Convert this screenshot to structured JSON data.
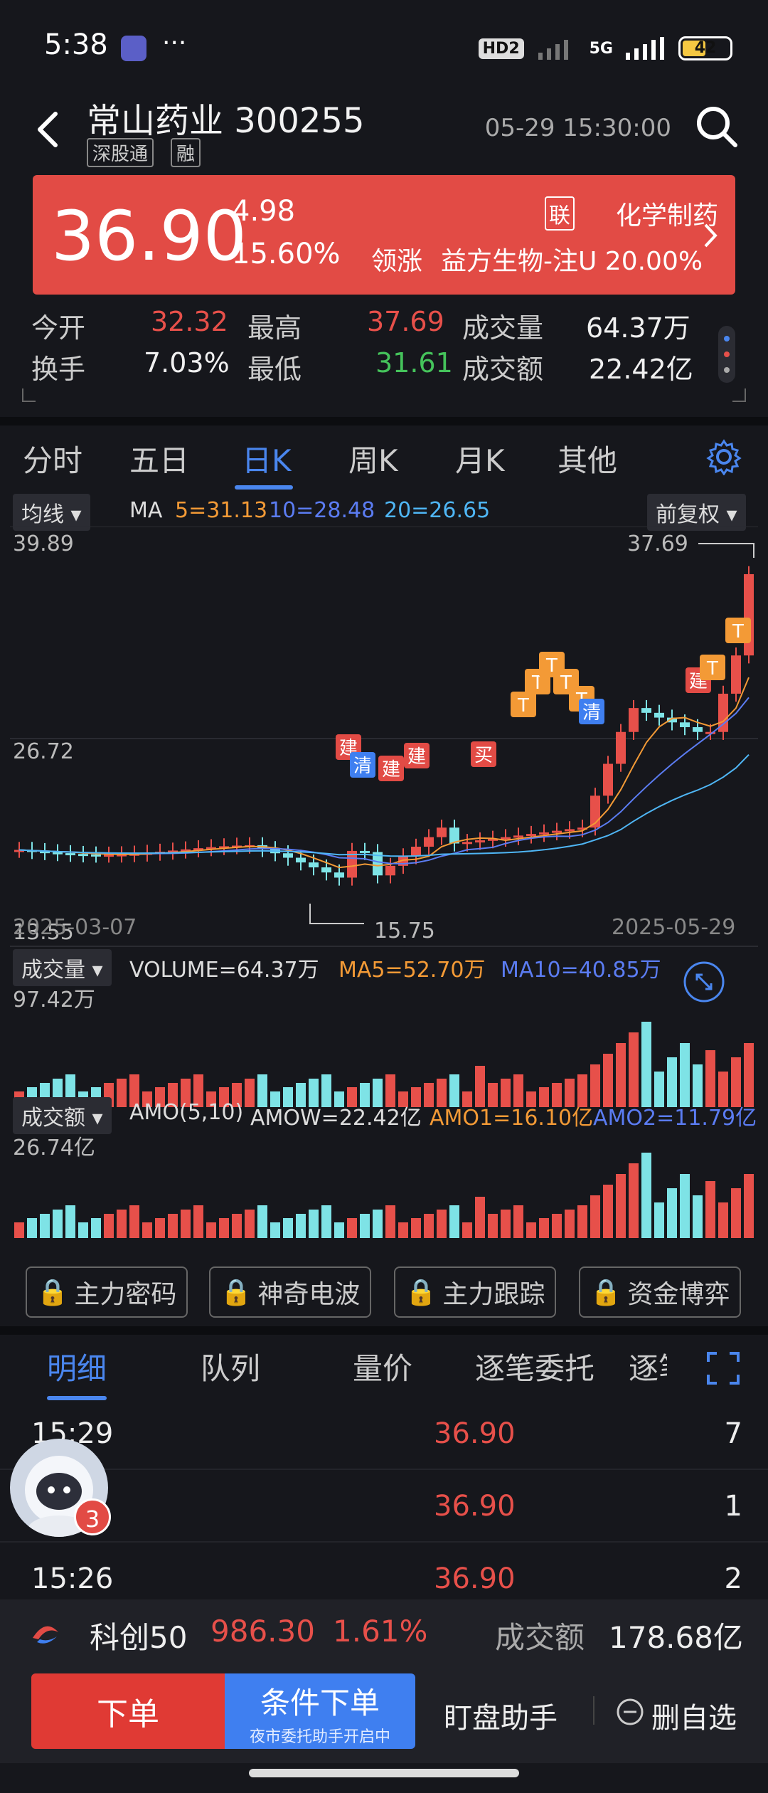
{
  "status_bar": {
    "time": "5:38",
    "dots": "···",
    "hd": "HD2",
    "network": "5G",
    "battery": "42"
  },
  "header": {
    "stock_name_code": "常山药业 300255",
    "tag_connect": "深股通",
    "tag_margin": "融",
    "datetime": "05-29 15:30:00"
  },
  "price_card": {
    "price": "36.90",
    "change": "4.98",
    "change_pct": "15.60%",
    "sector_tag": "联",
    "sector_name": "化学制药",
    "lead_label": "领涨",
    "lead_stock": "益方生物-注U 20.00%"
  },
  "quotes": {
    "open_label": "今开",
    "open": "32.32",
    "high_label": "最高",
    "high": "37.69",
    "volume_label": "成交量",
    "volume": "64.37万",
    "turnover_label": "换手",
    "turnover": "7.03%",
    "low_label": "最低",
    "low": "31.61",
    "amount_label": "成交额",
    "amount": "22.42亿"
  },
  "chart_tabs": [
    "分时",
    "五日",
    "日K",
    "周K",
    "月K",
    "其他"
  ],
  "kline": {
    "indicator_btn": "均线",
    "ma_label": "MA",
    "ma5": "5=31.13",
    "ma10": "10=28.48",
    "ma20": "20=26.65",
    "adjust_btn": "前复权",
    "y_top": "39.89",
    "y_mid": "26.72",
    "y_bottom": "13.55",
    "high_mark": "37.69",
    "low_mark": "15.75",
    "date_start": "2025-03-07",
    "date_end": "2025-05-29",
    "signals": [
      "建",
      "清",
      "建",
      "建",
      "买",
      "T",
      "T",
      "T",
      "T",
      "T",
      "清",
      "建",
      "T",
      "T"
    ]
  },
  "volume_panel": {
    "btn": "成交量",
    "vol": "VOLUME=64.37万",
    "ma5": "MA5=52.70万",
    "ma10": "MA10=40.85万",
    "y_top": "97.42万"
  },
  "amount_panel": {
    "btn": "成交额",
    "amo": "AMO(5,10)",
    "amow": "AMOW=22.42亿",
    "amo1": "AMO1=16.10亿",
    "amo2": "AMO2=11.79亿",
    "y_top": "26.74亿"
  },
  "lock_buttons": [
    "主力密码",
    "神奇电波",
    "主力跟踪",
    "资金博弈"
  ],
  "detail_tabs": [
    "明细",
    "队列",
    "量价",
    "逐笔委托",
    "逐笔"
  ],
  "trades": [
    {
      "time": "15:29",
      "price": "36.90",
      "vol": "7"
    },
    {
      "time": "",
      "price": "36.90",
      "vol": "1"
    },
    {
      "time": "15:26",
      "price": "36.90",
      "vol": "2"
    }
  ],
  "avatar_badge": "3",
  "index_bar": {
    "name": "科创50",
    "value": "986.30",
    "pct": "1.61%",
    "amount_label": "成交额",
    "amount": "178.68亿"
  },
  "bottom_bar": {
    "order": "下单",
    "cond_order": "条件下单",
    "cond_sub": "夜市委托助手开启中",
    "assistant": "盯盘助手",
    "remove_fav": "删自选"
  },
  "colors": {
    "up": "#e7504a",
    "down": "#7ee3e6",
    "accent": "#4a86ee",
    "ma5": "#f39a36",
    "ma10": "#5b7cf2",
    "ma20": "#4fb6f5"
  }
}
